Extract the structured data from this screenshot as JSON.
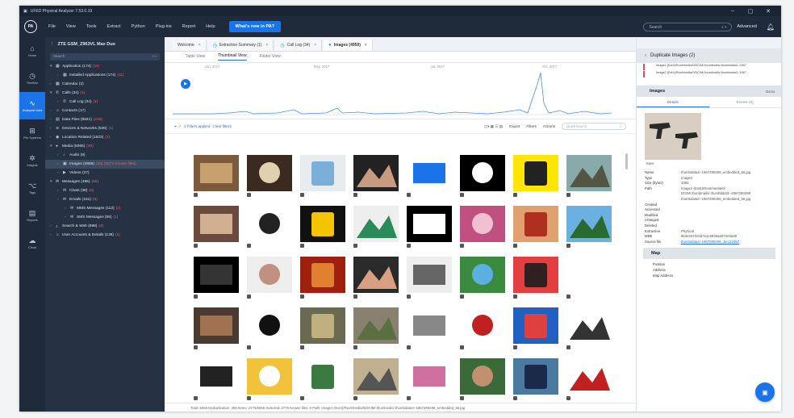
{
  "window": {
    "title": "UFED Physical Analyzer 7.53.0.19",
    "controls": [
      "–",
      "▢",
      "✕"
    ]
  },
  "menu": {
    "items": [
      "File",
      "View",
      "Tools",
      "Extract",
      "Python",
      "Plug-ins",
      "Report",
      "Help"
    ],
    "whats_new": "What's new in PA?",
    "search_placeholder": "Search",
    "advanced": "Advanced"
  },
  "rail": [
    {
      "icon": "⌂",
      "label": "Home",
      "name": "home"
    },
    {
      "icon": "◷",
      "label": "Timeline",
      "name": "timeline"
    },
    {
      "icon": "∿",
      "label": "Analyzed Data",
      "name": "analyzed-data"
    },
    {
      "icon": "⊞",
      "label": "File Systems",
      "name": "file-systems"
    },
    {
      "icon": "✲",
      "label": "Insights",
      "name": "insights"
    },
    {
      "icon": "⌥",
      "label": "Tags",
      "name": "tags"
    },
    {
      "icon": "▤",
      "label": "Reports",
      "name": "reports"
    },
    {
      "icon": "☁",
      "label": "Cloud",
      "name": "cloud"
    }
  ],
  "tree": {
    "device": "ZTE GSM_Z963VL Max Duo",
    "search_placeholder": "Search",
    "nodes": [
      {
        "label": "Application",
        "count": "(174)",
        "extra": "(11)",
        "depth": 0,
        "icon": "▦",
        "open": true
      },
      {
        "label": "Installed Applications",
        "count": "(174)",
        "extra": "(11)",
        "depth": 1,
        "icon": "▦",
        "open": false
      },
      {
        "label": "Calendar",
        "count": "(3)",
        "extra": "",
        "depth": 0,
        "icon": "▦",
        "open": false
      },
      {
        "label": "Calls",
        "count": "(34)",
        "extra": "(1)",
        "depth": 0,
        "icon": "✆",
        "open": true
      },
      {
        "label": "Call Log",
        "count": "(34)",
        "extra": "(1)",
        "depth": 1,
        "icon": "✆",
        "open": false
      },
      {
        "label": "Contacts",
        "count": "(17)",
        "extra": "",
        "depth": 0,
        "icon": "☺",
        "open": false
      },
      {
        "label": "Data Files",
        "count": "(9841)",
        "extra": "(216)",
        "depth": 0,
        "icon": "▤",
        "open": false
      },
      {
        "label": "Devices & Networks",
        "count": "(636)",
        "extra": "(1)",
        "depth": 0,
        "icon": "≋",
        "open": false
      },
      {
        "label": "Location Related",
        "count": "(1523)",
        "extra": "(2)",
        "depth": 0,
        "icon": "◉",
        "open": false
      },
      {
        "label": "Media",
        "count": "(5065)",
        "extra": "(36)",
        "depth": 0,
        "icon": "●",
        "open": true
      },
      {
        "label": "Audio",
        "count": "(9)",
        "extra": "",
        "depth": 1,
        "icon": "♪",
        "open": false
      },
      {
        "label": "Images",
        "count": "(4959)",
        "extra": "(36) (3674 Known files)",
        "depth": 1,
        "icon": "▣",
        "open": false,
        "selected": true
      },
      {
        "label": "Videos",
        "count": "(27)",
        "extra": "",
        "depth": 1,
        "icon": "▶",
        "open": false
      },
      {
        "label": "Messages",
        "count": "(485)",
        "extra": "(66)",
        "depth": 0,
        "icon": "✉",
        "open": true
      },
      {
        "label": "Chats",
        "count": "(38)",
        "extra": "(6)",
        "depth": 1,
        "icon": "✉",
        "open": false
      },
      {
        "label": "Emails",
        "count": "(151)",
        "extra": "(6)",
        "depth": 1,
        "icon": "✉",
        "open": false
      },
      {
        "label": "MMS Messages",
        "count": "(113)",
        "extra": "(2)",
        "depth": 2,
        "icon": "✉",
        "open": false
      },
      {
        "label": "SMS Messages",
        "count": "(95)",
        "extra": "(1)",
        "depth": 2,
        "icon": "✉",
        "open": false
      },
      {
        "label": "Search & Web",
        "count": "(898)",
        "extra": "(4)",
        "depth": 0,
        "icon": "⌕",
        "open": false
      },
      {
        "label": "User Accounts & Details",
        "count": "(138)",
        "extra": "(1)",
        "depth": 0,
        "icon": "☺",
        "open": false
      }
    ]
  },
  "tabs": [
    {
      "label": "Welcome",
      "icon": "",
      "active": false
    },
    {
      "label": "Extraction Summary (1)",
      "icon": "◷",
      "active": false
    },
    {
      "label": "Call Log (34)",
      "icon": "◷",
      "active": false
    },
    {
      "label": "Images (4959)",
      "icon": "●",
      "active": true
    }
  ],
  "subtabs": [
    {
      "label": "Table View",
      "active": false
    },
    {
      "label": "Thumbnail View",
      "active": true
    },
    {
      "label": "Folder View",
      "active": false
    }
  ],
  "timeline": {
    "labels": [
      "Jan, 2017",
      "May, 2017",
      "Jul, 2017",
      "Oct, 2017"
    ]
  },
  "filterbar": {
    "applied": "1 Filters applied",
    "clear": "Clear filters",
    "export": "Export",
    "filters": "Filters",
    "actions": "Actions",
    "search_placeholder": "Quick search"
  },
  "thumbnails": [
    "restaurant-crowd",
    "hitman-poster",
    "map-screenshot",
    "woman-portrait",
    "sports-logo",
    "glowing-orb",
    "snapchat-logo",
    "street-store",
    "diner-interior",
    "pistol",
    "hertz-logo",
    "cartoon-face",
    "facebook-text",
    "pink-hair-woman",
    "pizza",
    "palm-beach",
    "black-frame",
    "man-glasses",
    "fire-boxes",
    "bearded-man",
    "phone-small",
    "river-landscape",
    "costume-group",
    "blank",
    "doorway",
    "star-logo",
    "gollum",
    "aerial-town",
    "document-text",
    "flowers-red",
    "two-people",
    "sticker-text",
    "small-bottle",
    "yellow-card",
    "green-figure",
    "newspaper",
    "flower-art",
    "stadium-woman",
    "police-officer",
    "coke-can"
  ],
  "statusbar": "Total: 5065    Deduplication: 306    Items: 2776/5065    Selected: 2776    Known files: 0    Path: Image2 (Ext4)/Root/media/0/DCIM/.thumbnails/.thumbdata3--1967290289_embedded_56.jpg",
  "right": {
    "dup_title": "Duplicate Images (2)",
    "dup_rows": [
      "Image2 (Ext4)/Root/media/0/DCIM/.thumbnails/.thumbdata3--1967",
      "Image2 (Ext4)/Root/media/0/DCIM/.thumbnails/.thumbdata3--1967"
    ],
    "images_title": "Images",
    "go_to": "Go to",
    "tab_details": "Details",
    "tab_extra": "Events (0)",
    "save": "Save",
    "props": [
      {
        "k": "Name",
        "v": "thumbdata3--1967290289_embedded_56.jpg",
        "link": false
      },
      {
        "k": "Type",
        "v": "Images",
        "link": false
      },
      {
        "k": "Size (bytes)",
        "v": "3393",
        "link": false
      },
      {
        "k": "Path",
        "v": "Image2 (Ext4)/Root/media/0/",
        "link": false
      },
      {
        "k": "",
        "v": "DCIM/.thumbnails/.thumbdata3--1967290289",
        "link": false
      },
      {
        "k": "",
        "v": "thumbdata3--1967290289_embedded_56.jpg",
        "link": false
      },
      {
        "k": "Created",
        "v": "",
        "link": false
      },
      {
        "k": "Accessed",
        "v": "",
        "link": false
      },
      {
        "k": "Modified",
        "v": "",
        "link": false
      },
      {
        "k": "Changed",
        "v": "",
        "link": false
      },
      {
        "k": "Deleted",
        "v": "",
        "link": false
      },
      {
        "k": "Extraction",
        "v": "Physical",
        "link": false
      },
      {
        "k": "MD5",
        "v": "8b3ee972e0d7eac6836aa674e5a39",
        "link": false
      },
      {
        "k": "Source file",
        "v": "thumbdata3--1967290289...5e122d57",
        "link": true
      }
    ],
    "map_title": "Map",
    "map_rows": [
      "Position",
      "Address",
      "Map Address"
    ]
  }
}
